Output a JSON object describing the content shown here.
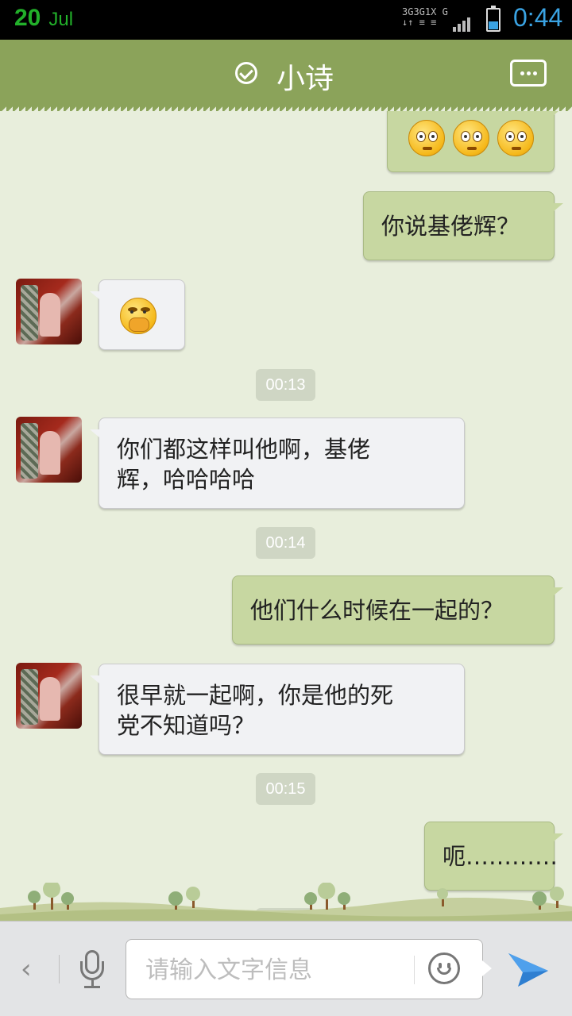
{
  "status_bar": {
    "date_day": "20",
    "date_month": "Jul",
    "network_labels": [
      "3G",
      "3G",
      "1X",
      "G"
    ],
    "time": "0:44",
    "battery_icon": "battery-icon",
    "signal_icon": "signal-icon"
  },
  "header": {
    "title": "小诗",
    "status_icon": "check-circle-icon",
    "menu_icon": "chat-more-icon"
  },
  "messages": [
    {
      "side": "out",
      "type": "emoji",
      "emoji": [
        "shocked-emoji",
        "shocked-emoji",
        "shocked-emoji"
      ]
    },
    {
      "side": "out",
      "type": "text",
      "text": "你说基佬辉？"
    },
    {
      "side": "in",
      "type": "emoji",
      "emoji": [
        "covering-mouth-emoji"
      ]
    },
    {
      "type": "time",
      "text": "00:13"
    },
    {
      "side": "in",
      "type": "text",
      "lines": [
        "你们都这样叫他啊，基佬",
        "辉，哈哈哈哈"
      ]
    },
    {
      "type": "time",
      "text": "00:14"
    },
    {
      "side": "out",
      "type": "text",
      "text": "他们什么时候在一起的？"
    },
    {
      "side": "in",
      "type": "text",
      "lines": [
        "很早就一起啊，你是他的死",
        "党不知道吗？"
      ]
    },
    {
      "type": "time",
      "text": "00:15"
    },
    {
      "side": "out",
      "type": "text",
      "text": "呃…………"
    }
  ],
  "input_bar": {
    "back_icon": "chevron-left-icon",
    "back_glyph": "‹",
    "mic_icon": "microphone-icon",
    "placeholder": "请输入文字信息",
    "emoji_icon": "smiley-icon",
    "send_icon": "send-icon"
  },
  "colors": {
    "header": "#8ba35a",
    "outgoing_bubble": "#c7d7a1",
    "incoming_bubble": "#f1f2f4",
    "chat_background": "#e8eedc",
    "status_time": "#3aa3e3",
    "status_date": "#22b02a"
  }
}
